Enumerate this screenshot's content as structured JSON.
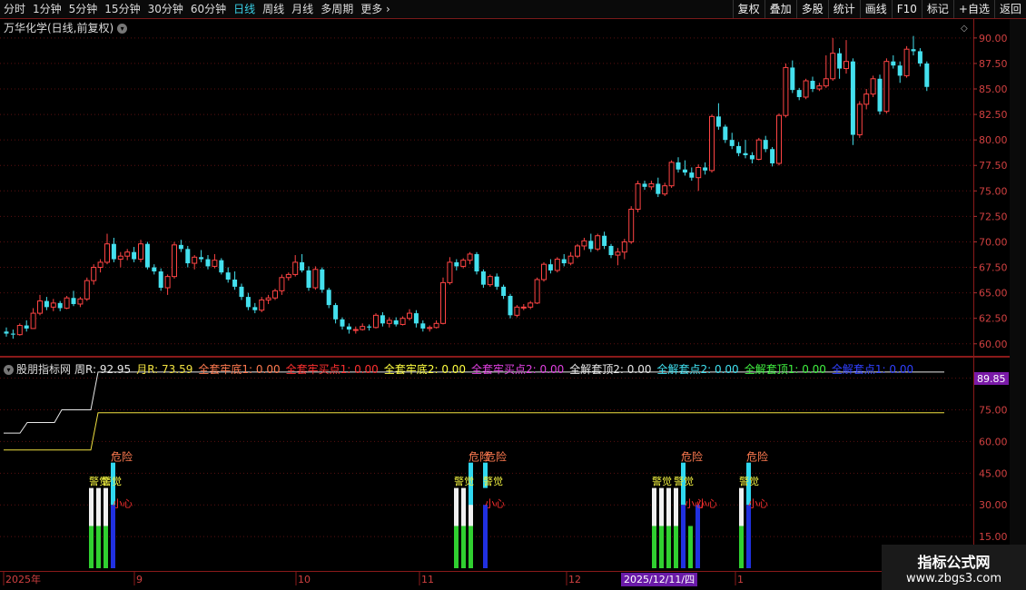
{
  "toolbar": {
    "periods": [
      {
        "label": "分时"
      },
      {
        "label": "1分钟"
      },
      {
        "label": "5分钟"
      },
      {
        "label": "15分钟"
      },
      {
        "label": "30分钟"
      },
      {
        "label": "60分钟"
      },
      {
        "label": "日线",
        "active": true
      },
      {
        "label": "周线"
      },
      {
        "label": "月线"
      },
      {
        "label": "多周期"
      },
      {
        "label": "更多"
      }
    ],
    "actions": [
      {
        "label": "复权"
      },
      {
        "label": "叠加"
      },
      {
        "label": "多股"
      },
      {
        "label": "统计"
      },
      {
        "label": "画线"
      },
      {
        "label": "F10"
      },
      {
        "label": "标记"
      },
      {
        "label": "+自选"
      },
      {
        "label": "返回"
      }
    ]
  },
  "main_chart": {
    "title": "万华化学(日线,前复权)",
    "y_ticks": [
      "90.00",
      "87.50",
      "85.00",
      "82.50",
      "80.00",
      "77.50",
      "75.00",
      "72.50",
      "70.00",
      "67.50",
      "65.00",
      "62.50",
      "60.00"
    ],
    "y_range": [
      59,
      91.5
    ]
  },
  "indicator": {
    "name": "股朋指标网",
    "fields": [
      {
        "label": "周R: 92.95",
        "color": "#e8e8e8"
      },
      {
        "label": "月R: 73.59",
        "color": "#f0e040"
      },
      {
        "label": "全套牢底1: 0.00",
        "color": "#ff7a50"
      },
      {
        "label": "全套牢买点1: 0.00",
        "color": "#ff3030"
      },
      {
        "label": "全套牢底2: 0.00",
        "color": "#ffff40"
      },
      {
        "label": "全套牢买点2: 0.00",
        "color": "#e040e0"
      },
      {
        "label": "全解套顶2: 0.00",
        "color": "#e8e8e8"
      },
      {
        "label": "全解套点2: 0.00",
        "color": "#40e0f0"
      },
      {
        "label": "全解套顶1: 0.00",
        "color": "#40f040"
      },
      {
        "label": "全解套点1: 0.00",
        "color": "#3040ff"
      }
    ],
    "current_value": "89.85",
    "y_ticks": [
      "90.00",
      "75.00",
      "60.00",
      "45.00",
      "30.00",
      "15.00"
    ],
    "y_range": [
      0,
      95
    ],
    "labels": {
      "danger": "危险",
      "alert": "警觉",
      "caution": "小心"
    }
  },
  "x_axis": {
    "labels": [
      "2025年",
      "9",
      "10",
      "11",
      "12",
      "1"
    ],
    "cursor_date": "2025/12/11/四"
  },
  "watermark": {
    "line1": "指标公式网",
    "line2": "www.zbgs3.com"
  },
  "chart_data": {
    "type": "candlestick",
    "title": "万华化学(日线,前复权)",
    "ohlc": [
      [
        61.2,
        61.6,
        60.7,
        61.0
      ],
      [
        61.0,
        61.4,
        60.5,
        60.9
      ],
      [
        60.9,
        62.0,
        60.8,
        61.8
      ],
      [
        61.8,
        62.3,
        61.2,
        61.5
      ],
      [
        61.5,
        63.5,
        61.5,
        63.0
      ],
      [
        63.0,
        64.8,
        62.8,
        64.2
      ],
      [
        64.2,
        64.6,
        63.3,
        63.6
      ],
      [
        63.6,
        64.4,
        63.2,
        64.0
      ],
      [
        64.0,
        64.2,
        63.2,
        63.5
      ],
      [
        63.5,
        64.7,
        63.4,
        64.5
      ],
      [
        64.5,
        65.2,
        63.7,
        63.9
      ],
      [
        63.9,
        64.6,
        63.6,
        64.4
      ],
      [
        64.4,
        66.5,
        64.2,
        66.2
      ],
      [
        66.2,
        67.8,
        65.8,
        67.5
      ],
      [
        67.5,
        68.3,
        67.0,
        68.0
      ],
      [
        68.0,
        70.8,
        67.8,
        69.8
      ],
      [
        69.8,
        70.4,
        68.0,
        68.3
      ],
      [
        68.3,
        69.0,
        67.5,
        68.6
      ],
      [
        68.6,
        69.3,
        68.2,
        69.0
      ],
      [
        69.0,
        69.5,
        68.0,
        68.3
      ],
      [
        68.3,
        70.2,
        68.0,
        69.8
      ],
      [
        69.8,
        70.0,
        67.3,
        67.5
      ],
      [
        67.5,
        67.8,
        66.8,
        67.1
      ],
      [
        67.1,
        67.4,
        65.2,
        65.5
      ],
      [
        65.5,
        66.8,
        64.8,
        66.6
      ],
      [
        66.6,
        70.0,
        66.4,
        69.7
      ],
      [
        69.7,
        70.2,
        69.0,
        69.3
      ],
      [
        69.3,
        69.6,
        67.5,
        67.9
      ],
      [
        67.9,
        68.7,
        67.3,
        68.5
      ],
      [
        68.5,
        69.2,
        68.0,
        68.3
      ],
      [
        68.3,
        68.7,
        67.3,
        67.6
      ],
      [
        67.6,
        68.8,
        67.4,
        68.2
      ],
      [
        68.2,
        68.4,
        66.8,
        67.0
      ],
      [
        67.0,
        67.5,
        66.0,
        66.3
      ],
      [
        66.3,
        67.1,
        65.3,
        65.6
      ],
      [
        65.6,
        65.9,
        64.3,
        64.6
      ],
      [
        64.6,
        65.0,
        63.3,
        63.6
      ],
      [
        63.6,
        64.0,
        63.0,
        63.3
      ],
      [
        63.3,
        64.6,
        63.1,
        64.3
      ],
      [
        64.3,
        64.8,
        63.9,
        64.5
      ],
      [
        64.5,
        65.4,
        64.3,
        65.2
      ],
      [
        65.2,
        66.8,
        64.8,
        66.5
      ],
      [
        66.5,
        67.0,
        66.2,
        66.8
      ],
      [
        66.8,
        68.7,
        66.6,
        68.0
      ],
      [
        68.0,
        68.8,
        67.0,
        67.2
      ],
      [
        67.2,
        67.6,
        65.2,
        65.5
      ],
      [
        65.5,
        67.6,
        65.3,
        67.3
      ],
      [
        67.3,
        67.5,
        65.0,
        65.3
      ],
      [
        65.3,
        65.5,
        63.5,
        63.8
      ],
      [
        63.8,
        64.0,
        62.0,
        62.4
      ],
      [
        62.4,
        62.6,
        61.4,
        61.7
      ],
      [
        61.7,
        62.0,
        61.0,
        61.4
      ],
      [
        61.4,
        61.7,
        61.0,
        61.4
      ],
      [
        61.4,
        62.0,
        61.3,
        61.7
      ],
      [
        61.7,
        61.9,
        61.3,
        61.6
      ],
      [
        61.6,
        63.0,
        61.5,
        62.8
      ],
      [
        62.8,
        63.1,
        61.7,
        62.0
      ],
      [
        62.0,
        62.6,
        61.6,
        62.3
      ],
      [
        62.3,
        62.6,
        61.7,
        61.9
      ],
      [
        61.9,
        62.7,
        61.8,
        62.5
      ],
      [
        62.5,
        63.4,
        62.3,
        63.0
      ],
      [
        63.0,
        63.3,
        61.6,
        62.0
      ],
      [
        62.0,
        62.3,
        61.2,
        61.5
      ],
      [
        61.5,
        61.8,
        61.2,
        61.6
      ],
      [
        61.6,
        62.3,
        61.5,
        62.0
      ],
      [
        62.0,
        66.5,
        61.9,
        66.0
      ],
      [
        66.0,
        68.5,
        65.8,
        68.0
      ],
      [
        68.0,
        68.3,
        67.2,
        67.6
      ],
      [
        67.6,
        68.4,
        67.4,
        68.2
      ],
      [
        68.2,
        69.0,
        67.8,
        68.8
      ],
      [
        68.8,
        69.0,
        66.8,
        67.1
      ],
      [
        67.1,
        67.3,
        65.5,
        65.8
      ],
      [
        65.8,
        66.8,
        65.6,
        66.6
      ],
      [
        66.6,
        66.9,
        65.3,
        65.6
      ],
      [
        65.6,
        65.8,
        64.4,
        64.7
      ],
      [
        64.7,
        64.9,
        62.5,
        62.8
      ],
      [
        62.8,
        63.8,
        62.6,
        63.6
      ],
      [
        63.6,
        63.9,
        63.3,
        63.6
      ],
      [
        63.6,
        64.2,
        63.4,
        64.0
      ],
      [
        64.0,
        66.5,
        63.9,
        66.3
      ],
      [
        66.3,
        68.0,
        66.1,
        67.8
      ],
      [
        67.8,
        68.3,
        66.9,
        67.2
      ],
      [
        67.2,
        68.5,
        67.0,
        68.3
      ],
      [
        68.3,
        68.8,
        67.6,
        67.9
      ],
      [
        67.9,
        69.0,
        67.7,
        68.6
      ],
      [
        68.6,
        69.8,
        68.4,
        69.6
      ],
      [
        69.6,
        70.4,
        69.2,
        70.1
      ],
      [
        70.1,
        70.8,
        69.0,
        69.3
      ],
      [
        69.3,
        70.8,
        69.1,
        70.6
      ],
      [
        70.6,
        71.0,
        69.3,
        69.6
      ],
      [
        69.6,
        69.8,
        68.4,
        68.7
      ],
      [
        68.7,
        69.4,
        67.7,
        69.0
      ],
      [
        69.0,
        70.3,
        68.3,
        70.0
      ],
      [
        70.0,
        73.5,
        69.8,
        73.2
      ],
      [
        73.2,
        76.0,
        72.9,
        75.7
      ],
      [
        75.7,
        76.0,
        75.1,
        75.4
      ],
      [
        75.4,
        76.0,
        75.1,
        75.7
      ],
      [
        75.7,
        76.3,
        74.4,
        74.7
      ],
      [
        74.7,
        75.8,
        74.5,
        75.5
      ],
      [
        75.5,
        78.0,
        75.3,
        77.8
      ],
      [
        77.8,
        78.3,
        76.8,
        77.1
      ],
      [
        77.1,
        78.0,
        76.5,
        76.8
      ],
      [
        76.8,
        77.3,
        76.0,
        76.3
      ],
      [
        76.3,
        77.6,
        75.0,
        77.3
      ],
      [
        77.3,
        77.8,
        76.6,
        77.0
      ],
      [
        77.0,
        82.5,
        76.8,
        82.3
      ],
      [
        82.3,
        83.6,
        81.0,
        81.3
      ],
      [
        81.3,
        81.5,
        79.7,
        80.0
      ],
      [
        80.0,
        80.7,
        79.1,
        79.4
      ],
      [
        79.4,
        79.8,
        78.4,
        78.7
      ],
      [
        78.7,
        80.0,
        78.2,
        78.5
      ],
      [
        78.5,
        78.8,
        77.7,
        78.1
      ],
      [
        78.1,
        80.2,
        78.0,
        80.0
      ],
      [
        80.0,
        80.4,
        78.8,
        79.1
      ],
      [
        79.1,
        79.3,
        77.4,
        77.7
      ],
      [
        77.7,
        82.6,
        77.5,
        82.4
      ],
      [
        82.4,
        87.5,
        82.2,
        87.1
      ],
      [
        87.1,
        87.8,
        84.6,
        84.9
      ],
      [
        84.9,
        85.1,
        83.9,
        84.2
      ],
      [
        84.2,
        86.0,
        84.0,
        85.8
      ],
      [
        85.8,
        86.2,
        84.7,
        85.0
      ],
      [
        85.0,
        85.6,
        84.8,
        85.3
      ],
      [
        85.3,
        88.3,
        85.1,
        86.0
      ],
      [
        86.0,
        90.0,
        85.8,
        88.5
      ],
      [
        88.5,
        89.0,
        86.0,
        87.0
      ],
      [
        87.0,
        89.8,
        86.5,
        87.7
      ],
      [
        87.7,
        88.0,
        79.5,
        80.5
      ],
      [
        80.5,
        83.8,
        80.2,
        83.5
      ],
      [
        83.5,
        85.0,
        83.0,
        84.5
      ],
      [
        84.5,
        86.3,
        84.2,
        86.0
      ],
      [
        86.0,
        86.4,
        82.5,
        82.8
      ],
      [
        82.8,
        88.0,
        82.6,
        87.7
      ],
      [
        87.7,
        88.3,
        87.0,
        87.3
      ],
      [
        87.3,
        87.7,
        85.6,
        86.3
      ],
      [
        86.3,
        89.2,
        86.1,
        88.9
      ],
      [
        88.9,
        90.2,
        88.3,
        88.7
      ],
      [
        88.7,
        89.0,
        87.2,
        87.5
      ],
      [
        87.5,
        87.7,
        84.8,
        85.2
      ]
    ]
  }
}
